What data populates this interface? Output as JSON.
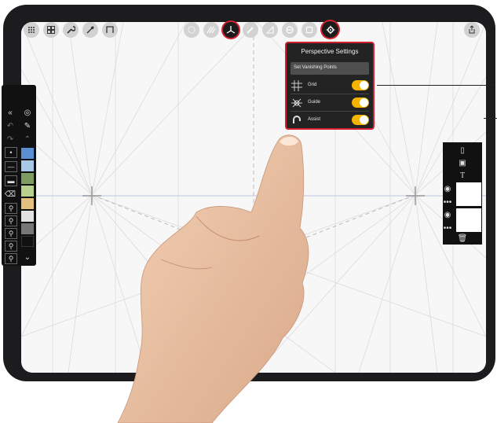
{
  "popup": {
    "title": "Perspective Settings",
    "vanishing_button": "Set Vanishing Points",
    "rows": [
      {
        "label": "Grid",
        "icon": "grid-icon",
        "on": true
      },
      {
        "label": "Guide",
        "icon": "guide-icon",
        "on": true
      },
      {
        "label": "Assist",
        "icon": "magnet-icon",
        "on": true
      }
    ]
  },
  "toolbar": {
    "left_icons": [
      "apps-icon",
      "gallery-icon",
      "wrench-icon",
      "transform-icon",
      "crop-icon"
    ],
    "center_icons": [
      "symmetry-icon",
      "hatch-icon",
      "perspective-icon",
      "pencil-icon",
      "ruler-icon",
      "ellipse-icon",
      "square-icon",
      "gear-icon"
    ],
    "share_icon": "share-icon"
  },
  "palette": {
    "colors": [
      "#5b8fd4",
      "#a9c8e8",
      "#7e9c62",
      "#b9cf8f",
      "#e4c07e",
      "#e2e2e2",
      "#777777",
      "#111111"
    ]
  },
  "layers": {
    "icons": [
      "new-file-icon",
      "image-icon",
      "text-icon",
      "trash-icon"
    ]
  },
  "accent": "#f5b400",
  "highlight": "#d32030"
}
